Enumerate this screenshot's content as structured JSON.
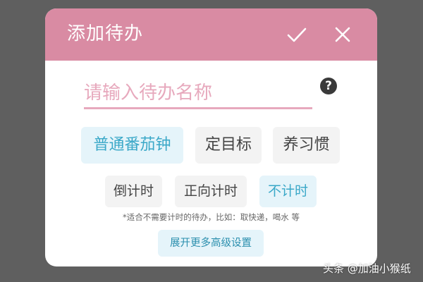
{
  "colors": {
    "header_bg": "#d98ba3",
    "underline": "#e7a9bd",
    "backdrop": "#5f5f5f",
    "active_chip_bg": "#e5f4fa",
    "active_chip_text": "#3aa8c8"
  },
  "dialog": {
    "title": "添加待办",
    "confirm_icon": "checkmark-icon",
    "close_icon": "close-icon",
    "name_input": {
      "placeholder": "请输入待办名称",
      "value": ""
    },
    "help_icon": "question-circle-icon",
    "help_glyph": "?",
    "modes": [
      {
        "label": "普通番茄钟",
        "selected": true
      },
      {
        "label": "定目标",
        "selected": false
      },
      {
        "label": "养习惯",
        "selected": false
      }
    ],
    "timer_types": [
      {
        "label": "倒计时",
        "selected": false
      },
      {
        "label": "正向计时",
        "selected": false
      },
      {
        "label": "不计时",
        "selected": true
      }
    ],
    "hint": "*适合不需要计时的待办，比如：取快递，喝水 等",
    "advanced_button": "展开更多高级设置"
  },
  "watermark": "头条 @加油小猴纸"
}
